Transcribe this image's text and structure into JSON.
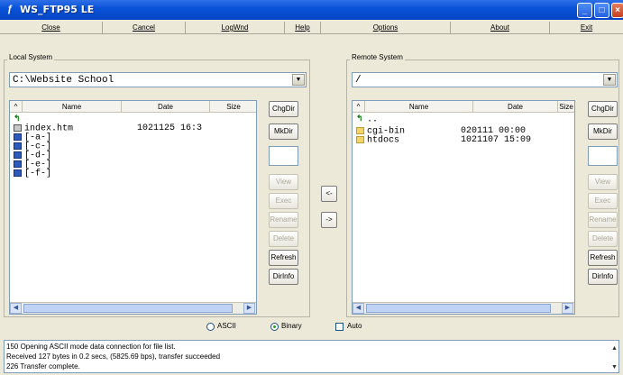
{
  "window": {
    "title": "WS_FTP95 LE"
  },
  "menu": [
    {
      "label": "Close"
    },
    {
      "label": "Cancel"
    },
    {
      "label": "LogWnd"
    },
    {
      "label": "Help"
    },
    {
      "label": "Options"
    },
    {
      "label": "About"
    },
    {
      "label": "Exit"
    }
  ],
  "local": {
    "group_label": "Local System",
    "path": "C:\\Website School",
    "columns": [
      "^",
      "Name",
      "Date",
      "Size"
    ],
    "files": [
      {
        "icon": "up-dir-icon",
        "name": "",
        "date": ""
      },
      {
        "icon": "file-icon",
        "name": "index.htm",
        "date": "1021125 16:3"
      },
      {
        "icon": "drive-icon",
        "name": "[-a-]",
        "date": ""
      },
      {
        "icon": "drive-icon",
        "name": "[-c-]",
        "date": ""
      },
      {
        "icon": "drive-icon",
        "name": "[-d-]",
        "date": ""
      },
      {
        "icon": "drive-icon",
        "name": "[-e-]",
        "date": ""
      },
      {
        "icon": "drive-icon",
        "name": "[-f-]",
        "date": ""
      }
    ],
    "buttons": {
      "chgdir": "ChgDir",
      "mkdir": "MkDir",
      "view": "View",
      "exec": "Exec",
      "rename": "Rename",
      "delete": "Delete",
      "refresh": "Refresh",
      "dirinfo": "DirInfo"
    }
  },
  "remote": {
    "group_label": "Remote System",
    "path": "/",
    "columns": [
      "^",
      "Name",
      "Date",
      "Size"
    ],
    "files": [
      {
        "icon": "up-dir-icon",
        "name": "..",
        "date": ""
      },
      {
        "icon": "folder-icon",
        "name": "cgi-bin",
        "date": "020111 00:00"
      },
      {
        "icon": "folder-icon",
        "name": "htdocs",
        "date": "1021107 15:09"
      }
    ],
    "buttons": {
      "chgdir": "ChgDir",
      "mkdir": "MkDir",
      "view": "View",
      "exec": "Exec",
      "rename": "Rename",
      "delete": "Delete",
      "refresh": "Refresh",
      "dirinfo": "DirInfo"
    }
  },
  "transfer": {
    "to_local": "<-",
    "to_remote": "->"
  },
  "mode": {
    "ascii": "ASCII",
    "binary": "Binary",
    "auto": "Auto",
    "selected": "Binary"
  },
  "log": [
    "150 Opening ASCII mode data connection for file list.",
    "Received 127 bytes in 0.2 secs, (5825.69 bps), transfer succeeded",
    "226 Transfer complete."
  ]
}
